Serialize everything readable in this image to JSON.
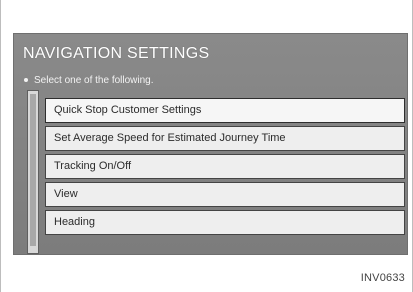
{
  "screen": {
    "title": "NAVIGATION SETTINGS",
    "prompt": "Select one of the following.",
    "menu_items": [
      {
        "label": "Quick Stop Customer Settings"
      },
      {
        "label": "Set Average Speed for Estimated Journey Time"
      },
      {
        "label": "Tracking On/Off"
      },
      {
        "label": "View"
      },
      {
        "label": "Heading"
      }
    ]
  },
  "figure_code": "INV0633"
}
